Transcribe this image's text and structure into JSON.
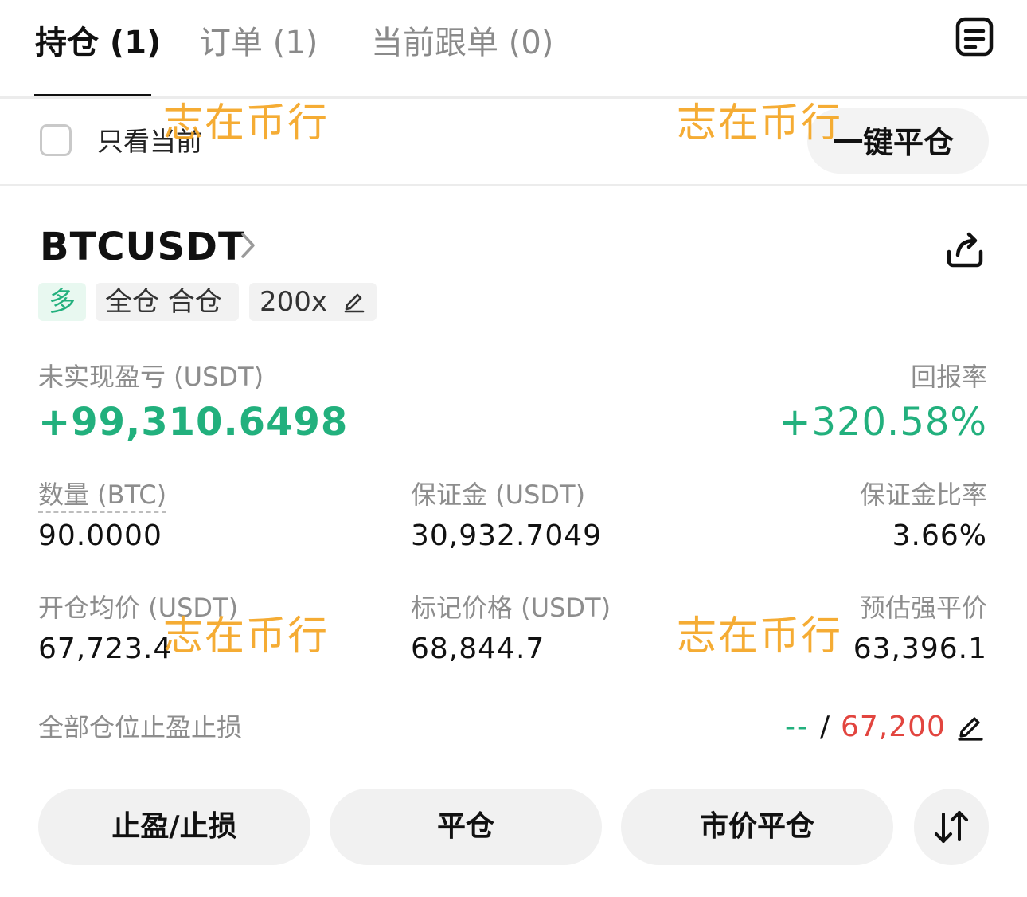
{
  "tabs": [
    {
      "label": "持仓 (1)",
      "active": true
    },
    {
      "label": "订单 (1)",
      "active": false
    },
    {
      "label": "当前跟单 (0)",
      "active": false
    }
  ],
  "header": {
    "orders_icon": "document-list-icon"
  },
  "filter": {
    "only_current_label": "只看当前",
    "close_all_label": "一键平仓"
  },
  "position": {
    "symbol": "BTCUSDT",
    "share_icon": "share-icon",
    "tags": {
      "side": "多",
      "margin_mode": "全仓 合仓",
      "leverage": "200x"
    },
    "unrealized_pnl_label": "未实现盈亏 (USDT)",
    "unrealized_pnl_value": "+99,310.6498",
    "roe_label": "回报率",
    "roe_value": "+320.58%",
    "quantity_label": "数量 (BTC)",
    "quantity_value": "90.0000",
    "margin_label": "保证金 (USDT)",
    "margin_value": "30,932.7049",
    "margin_ratio_label": "保证金比率",
    "margin_ratio_value": "3.66%",
    "entry_price_label": "开仓均价 (USDT)",
    "entry_price_value": "67,723.4",
    "mark_price_label": "标记价格 (USDT)",
    "mark_price_value": "68,844.7",
    "liq_price_label": "预估强平价",
    "liq_price_value": "63,396.1",
    "tpsl_label": "全部仓位止盈止损",
    "tp_value": "--",
    "tpsl_separator": "/",
    "sl_value": "67,200"
  },
  "actions": {
    "tpsl": "止盈/止损",
    "close": "平仓",
    "market_close": "市价平仓",
    "reverse_icon": "swap-arrows-icon"
  },
  "watermark": "志在币行",
  "colors": {
    "green": "#22b07d",
    "red": "#e2453f",
    "watermark": "#f5a623"
  }
}
